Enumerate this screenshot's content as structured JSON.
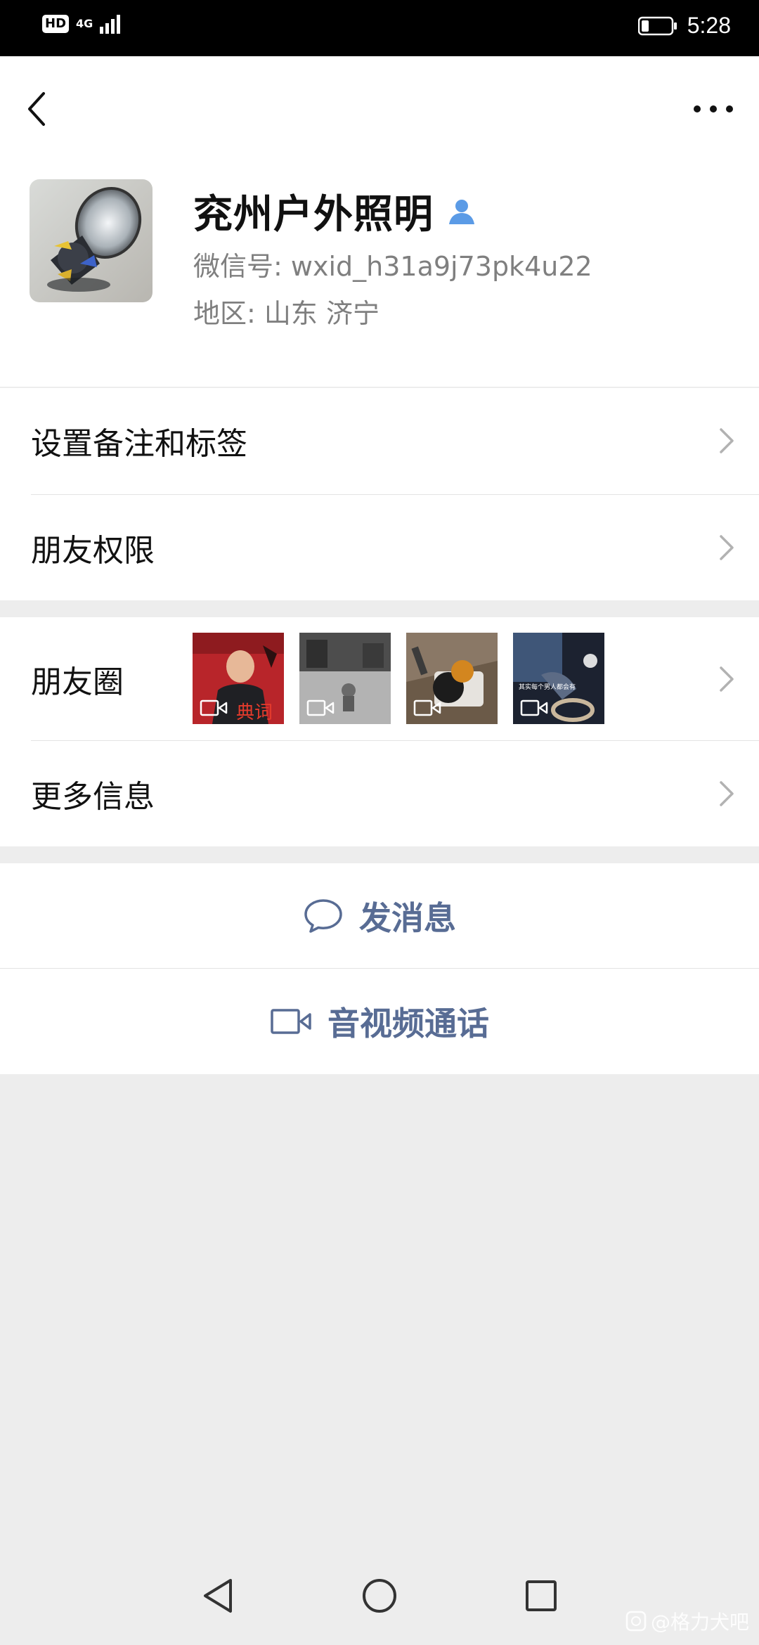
{
  "status_bar": {
    "hd": "HD",
    "network": "4G",
    "time": "5:28"
  },
  "profile": {
    "name": "兖州户外照明",
    "wechat_id": "微信号: wxid_h31a9j73pk4u22",
    "region": "地区: 山东  济宁"
  },
  "menu": {
    "remarks_tags": "设置备注和标签",
    "friend_permissions": "朋友权限",
    "moments": "朋友圈",
    "more_info": "更多信息"
  },
  "actions": {
    "send_message": "发消息",
    "video_call": "音视频通话"
  },
  "moments_thumbs": [
    {
      "caption": "典词"
    },
    {
      "caption": ""
    },
    {
      "caption": ""
    },
    {
      "caption": "其实每个男人都会有"
    }
  ],
  "watermark": "@格力犬吧",
  "colors": {
    "action_text": "#586c94",
    "verified_icon": "#5b9be6",
    "background": "#ededed"
  }
}
